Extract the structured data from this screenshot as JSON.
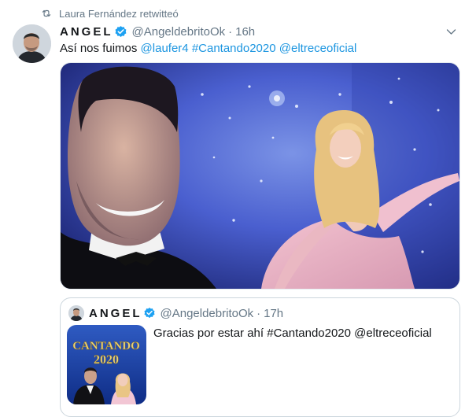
{
  "retweet": {
    "icon": "retweet-icon",
    "text": "Laura Fernández retwitteó"
  },
  "tweet": {
    "name": "ANGEL",
    "handle": "@AngeldebritoOk",
    "separator": "·",
    "time": "16h",
    "text_plain": "Así nos fuimos",
    "mentions": [
      "@laufer4",
      "#Cantando2020",
      "@eltreceoficial"
    ],
    "link_color": "#1b95e0"
  },
  "quote": {
    "name": "ANGEL",
    "handle": "@AngeldebritoOk",
    "separator": "·",
    "time": "17h",
    "text": "Gracias por estar ahí #Cantando2020 @eltreceoficial",
    "thumb_logo": {
      "top": "CANTANDO",
      "bottom": "2020"
    }
  },
  "colors": {
    "verified": "#1da1f2",
    "muted": "#657786",
    "text": "#14171a"
  }
}
